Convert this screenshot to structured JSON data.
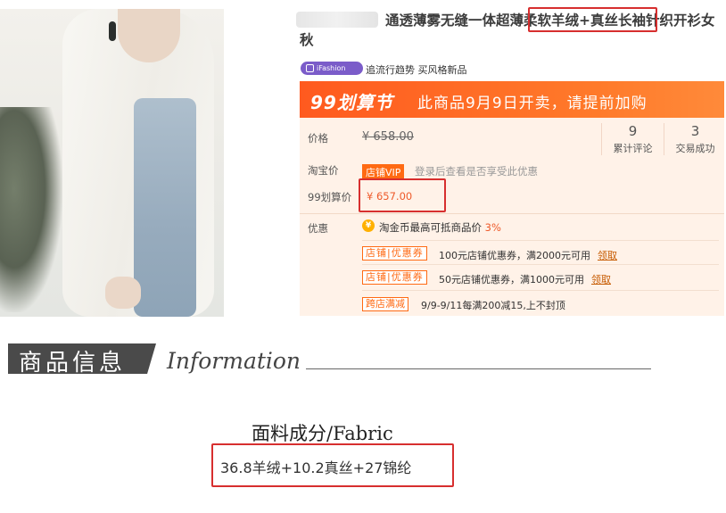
{
  "product": {
    "title": "通透薄雾无缝一体超薄柔软羊绒+真丝长袖针织开衫女秋",
    "ifashion_badge": "iFashion",
    "ifashion_tagline": "追流行趋势 买风格新品"
  },
  "banner": {
    "logo": "99划算节",
    "message": "此商品9月9日开卖，请提前加购"
  },
  "price": {
    "price_label": "价格",
    "original_price": "¥ 658.00",
    "taobao_label": "淘宝价",
    "vip_badge": "店铺VIP",
    "vip_note": "登录后查看是否享受此优惠",
    "price99_label": "99划算价",
    "price99_value": "¥ 657.00",
    "stats": [
      {
        "value": "9",
        "caption": "累计评论"
      },
      {
        "value": "3",
        "caption": "交易成功"
      }
    ]
  },
  "promotions": {
    "label": "优惠",
    "coin_icon": "coin-icon",
    "coin_text": "淘金币最高可抵商品价",
    "coin_pct": "3%",
    "coupons": [
      {
        "tag": "店铺|优惠券",
        "text": "100元店铺优惠券，满2000元可用",
        "claim": "领取"
      },
      {
        "tag": "店铺|优惠券",
        "text": "50元店铺优惠券，满1000元可用",
        "claim": "领取"
      }
    ],
    "cross_store": {
      "tag": "跨店满减",
      "text": "9/9-9/11每满200减15,上不封顶"
    }
  },
  "info": {
    "heading_cn": "商品信息",
    "heading_en": "Information"
  },
  "fabric": {
    "heading": "面料成分/Fabric",
    "value": "36.8羊绒+10.2真丝+27锦纶"
  },
  "colors": {
    "accent": "#ff5a1f",
    "highlight_box": "#d72f2f",
    "panel_bg": "#fff2e8"
  }
}
